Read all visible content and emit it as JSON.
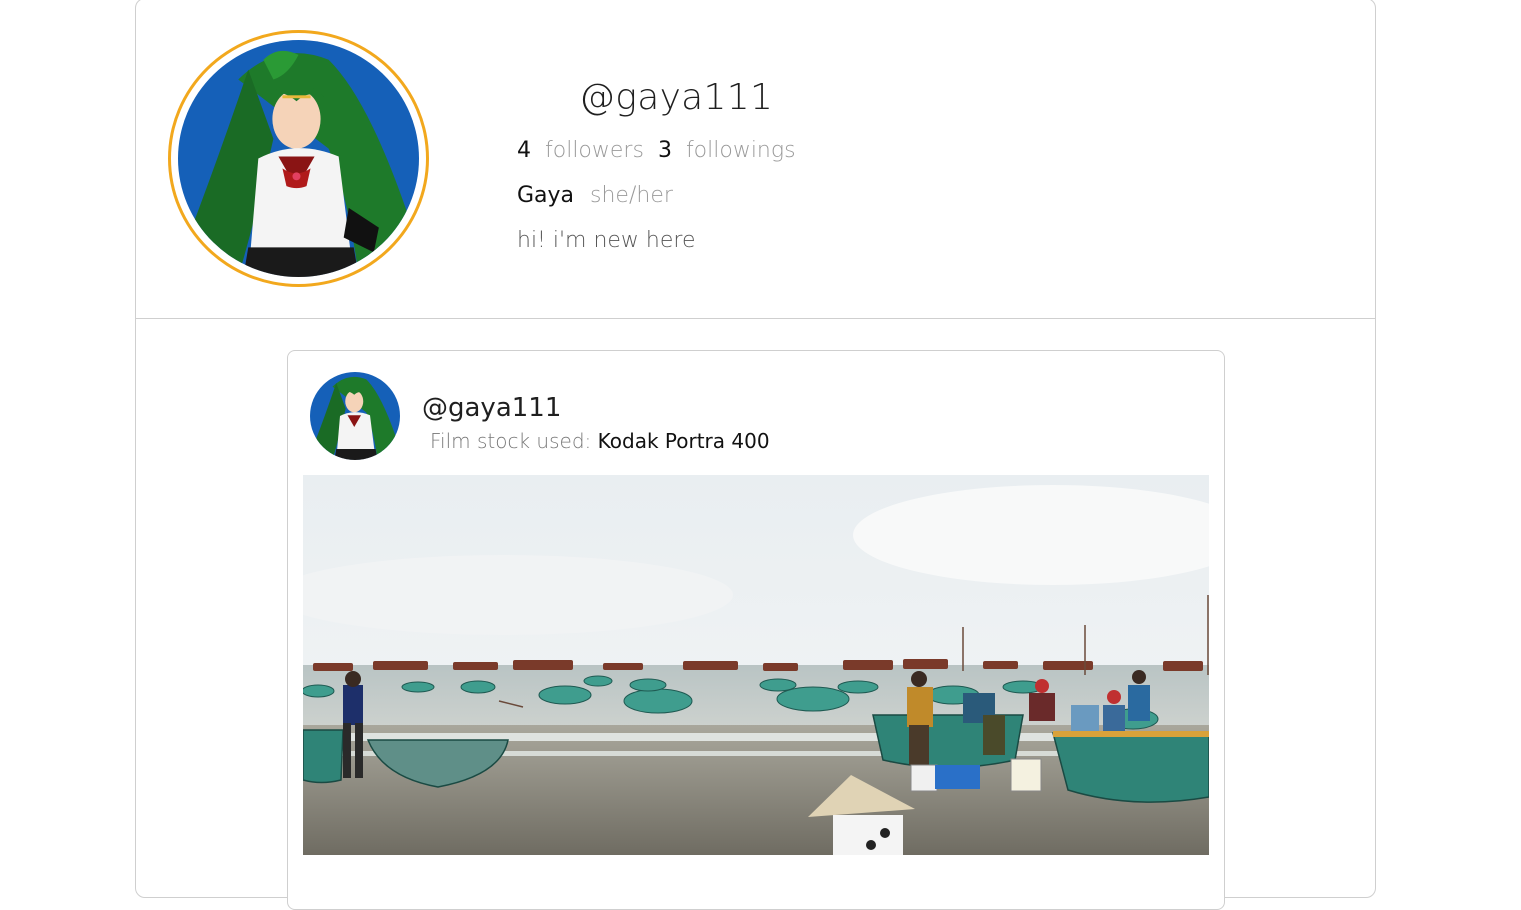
{
  "profile": {
    "username": "@gaya111",
    "followers_count": "4",
    "followers_label": "followers",
    "followings_count": "3",
    "followings_label": "followings",
    "display_name": "Gaya",
    "pronouns": "she/her",
    "bio": "hi! i'm new here",
    "avatar_icon": "anime-character-avatar",
    "avatar_ring_color": "#f2a81d"
  },
  "post": {
    "username": "@gaya111",
    "film_label": "Film stock used:",
    "film_value": "Kodak Portra 400",
    "photo_icon": "beach-boats-photo"
  }
}
